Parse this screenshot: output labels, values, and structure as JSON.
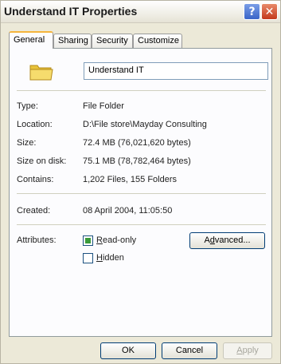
{
  "window": {
    "title": "Understand IT Properties"
  },
  "titlebar_buttons": {
    "help": "?",
    "close": "✕"
  },
  "tabs": [
    {
      "label": "General",
      "active": true
    },
    {
      "label": "Sharing",
      "active": false
    },
    {
      "label": "Security",
      "active": false
    },
    {
      "label": "Customize",
      "active": false
    }
  ],
  "general": {
    "name": "Understand IT",
    "type": {
      "label": "Type:",
      "value": "File Folder"
    },
    "location": {
      "label": "Location:",
      "value": "D:\\File store\\Mayday Consulting"
    },
    "size": {
      "label": "Size:",
      "value": "72.4 MB (76,021,620 bytes)"
    },
    "size_on_disk": {
      "label": "Size on disk:",
      "value": "75.1 MB (78,782,464 bytes)"
    },
    "contains": {
      "label": "Contains:",
      "value": "1,202 Files, 155 Folders"
    },
    "created": {
      "label": "Created:",
      "value": "08 April 2004, 11:05:50"
    },
    "attributes": {
      "label": "Attributes:",
      "read_only": {
        "accel": "R",
        "rest": "ead-only",
        "checked": true
      },
      "hidden": {
        "accel": "H",
        "rest": "idden",
        "checked": false
      },
      "advanced": {
        "before": "A",
        "accel": "d",
        "after": "vanced..."
      }
    }
  },
  "buttons": {
    "ok": "OK",
    "cancel": "Cancel",
    "apply": {
      "accel": "A",
      "rest": "pply",
      "disabled": true
    }
  },
  "colors": {
    "dialog_bg": "#ece9d8",
    "panel_bg": "#fcfcfe",
    "tab_highlight": "#f5b53d",
    "check_mark": "#3a9a3a"
  }
}
